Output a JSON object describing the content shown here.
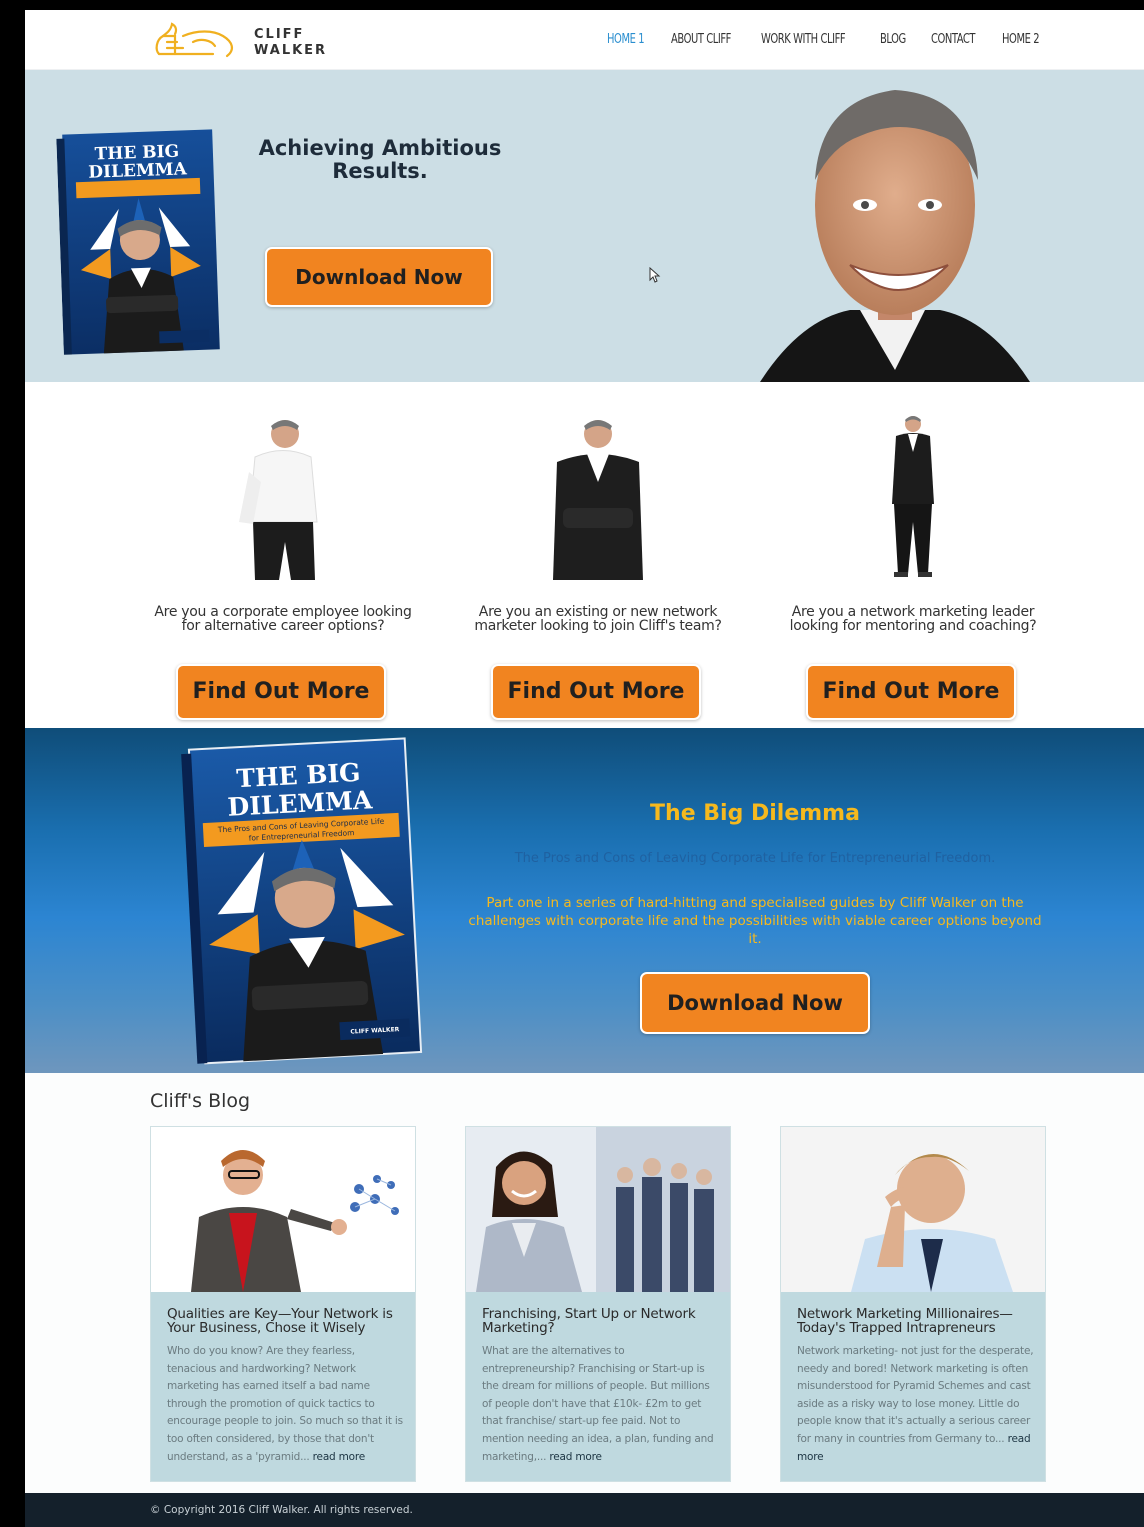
{
  "brand": {
    "line1": "CLIFF",
    "line2": "WALKER"
  },
  "nav": {
    "items": [
      {
        "label": "HOME 1",
        "active": true
      },
      {
        "label": "ABOUT CLIFF",
        "active": false
      },
      {
        "label": "WORK WITH CLIFF",
        "active": false
      },
      {
        "label": "BLOG",
        "active": false
      },
      {
        "label": "CONTACT",
        "active": false
      },
      {
        "label": "HOME 2",
        "active": false
      }
    ]
  },
  "hero": {
    "title_line1": "Achieving Ambitious",
    "title_line2": "Results.",
    "button": "Download Now"
  },
  "book": {
    "title_line1": "THE BIG",
    "title_line2": "DILEMMA",
    "ribbon_line1": "The Pros and Cons of Leaving Corporate Life",
    "ribbon_line2": "for Entrepreneurial Freedom",
    "brand_mark": "CLIFF WALKER"
  },
  "columns": [
    {
      "question_line1": "Are you a corporate employee looking",
      "question_line2": "for alternative career options?",
      "button": "Find Out More"
    },
    {
      "question_line1": "Are you an existing or new network",
      "question_line2": "marketer looking to join Cliff's team?",
      "button": "Find Out More"
    },
    {
      "question_line1": "Are you a network marketing leader",
      "question_line2": "looking for mentoring and coaching?",
      "button": "Find Out More"
    }
  ],
  "promo": {
    "title": "The Big Dilemma",
    "subtitle": "The Pros and Cons of Leaving Corporate Life for Entrepreneurial Freedom.",
    "description": "Part one in a series of hard-hitting and specialised guides by Cliff Walker on the challenges with corporate life and the possibilities with viable career options beyond it.",
    "button": "Download Now"
  },
  "blog": {
    "heading": "Cliff's Blog",
    "posts": [
      {
        "title": "Qualities are Key—Your Network is Your Business, Chose it Wisely",
        "excerpt": "Who do you know? Are they fearless, tenacious and hardworking? Network marketing has earned itself a bad name through the promotion of quick tactics to encourage people to join. So much so that it is too often considered, by those that don't understand, as a 'pyramid...",
        "more": "read more"
      },
      {
        "title": "Franchising, Start Up or Network Marketing?",
        "excerpt": "What are the alternatives to entrepreneurship? Franchising or Start-up is the dream for millions of people. But millions of people don't have that £10k- £2m to get that franchise/ start-up fee paid. Not to mention needing an idea, a plan, funding and marketing,...",
        "more": "read more"
      },
      {
        "title": "Network Marketing Millionaires—Today's Trapped Intrapreneurs",
        "excerpt": "Network marketing- not just for the desperate, needy and bored! Network marketing is often misunderstood for Pyramid Schemes and cast aside as a risky way to lose money. Little do people know that it's actually a serious career for many in countries from Germany to...",
        "more": "read more"
      }
    ]
  },
  "footer": {
    "copyright": "© Copyright 2016 Cliff Walker. All rights reserved."
  },
  "colors": {
    "accent_orange": "#f18420",
    "nav_active": "#2a8ecf",
    "promo_gold": "#f6b91e",
    "hero_bg": "#ccdee5"
  }
}
